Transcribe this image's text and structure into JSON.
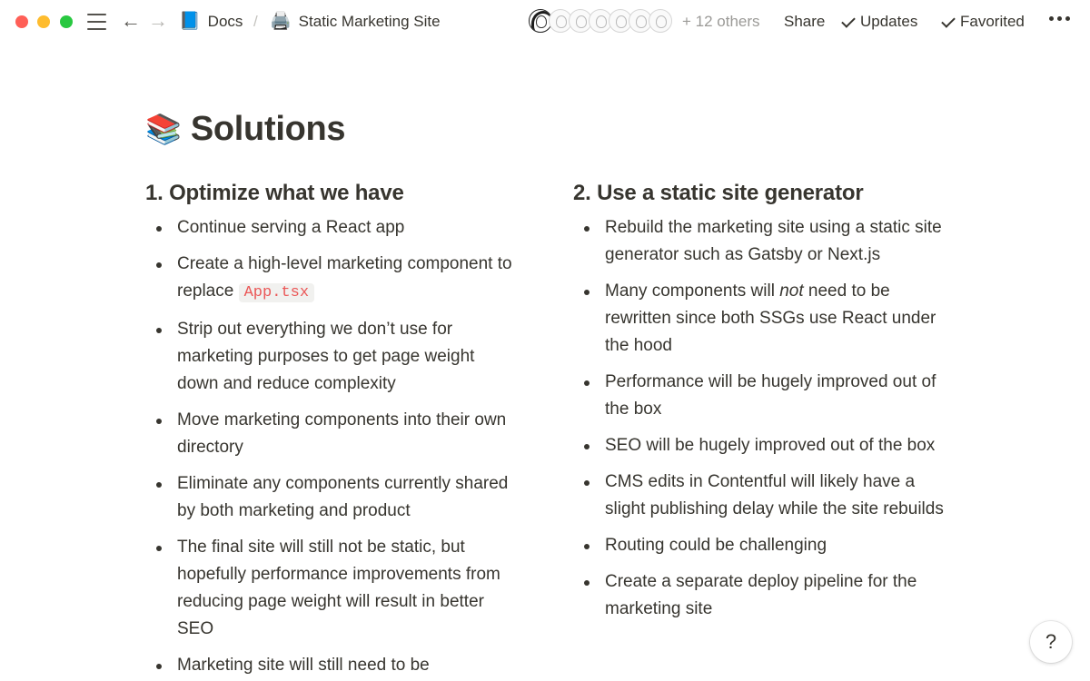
{
  "window": {
    "traffic_lights": {
      "close": "#ff5f57",
      "minimize": "#febc2e",
      "zoom": "#28c840"
    }
  },
  "topbar": {
    "menu_icon": "hamburger-icon",
    "back_icon": "←",
    "forward_icon": "→",
    "breadcrumb": [
      {
        "icon": "📘",
        "label": "Docs"
      },
      {
        "icon": "🖨️",
        "label": "Static Marketing Site"
      }
    ],
    "separator": "/",
    "collaborators_shown": 7,
    "others_label": "+ 12 others",
    "share_label": "Share",
    "updates_label": "Updates",
    "favorited_label": "Favorited"
  },
  "page": {
    "icon": "📚",
    "title": "Solutions",
    "sections": [
      {
        "heading": "1. Optimize what we have",
        "items": [
          "Continue serving a React app",
          "Create a high-level marketing component to replace",
          "Strip out everything we don’t use for marketing purposes to get page weight down and reduce complexity",
          "Move marketing components into their own directory",
          "Eliminate any components currently shared by both marketing and product",
          "The final site will still not be static, but hopefully performance improvements from reducing page weight will result in better SEO",
          "Marketing site will still need to be"
        ],
        "item_1_code": "App.tsx"
      },
      {
        "heading": "2. Use a static site generator",
        "items": [
          "Rebuild the marketing site using a static site generator such as Gatsby or Next.js",
          "Many components will",
          "Performance will be hugely improved out of the box",
          "SEO will be hugely improved out of the box",
          "CMS edits in Contentful will likely have a slight publishing delay while the site rebuilds",
          "Routing could be challenging",
          "Create a separate deploy pipeline for the marketing site"
        ],
        "item_1_em": "not",
        "item_1_rest": "need to be rewritten since both SSGs use React under the hood"
      }
    ]
  },
  "help": {
    "label": "?"
  }
}
